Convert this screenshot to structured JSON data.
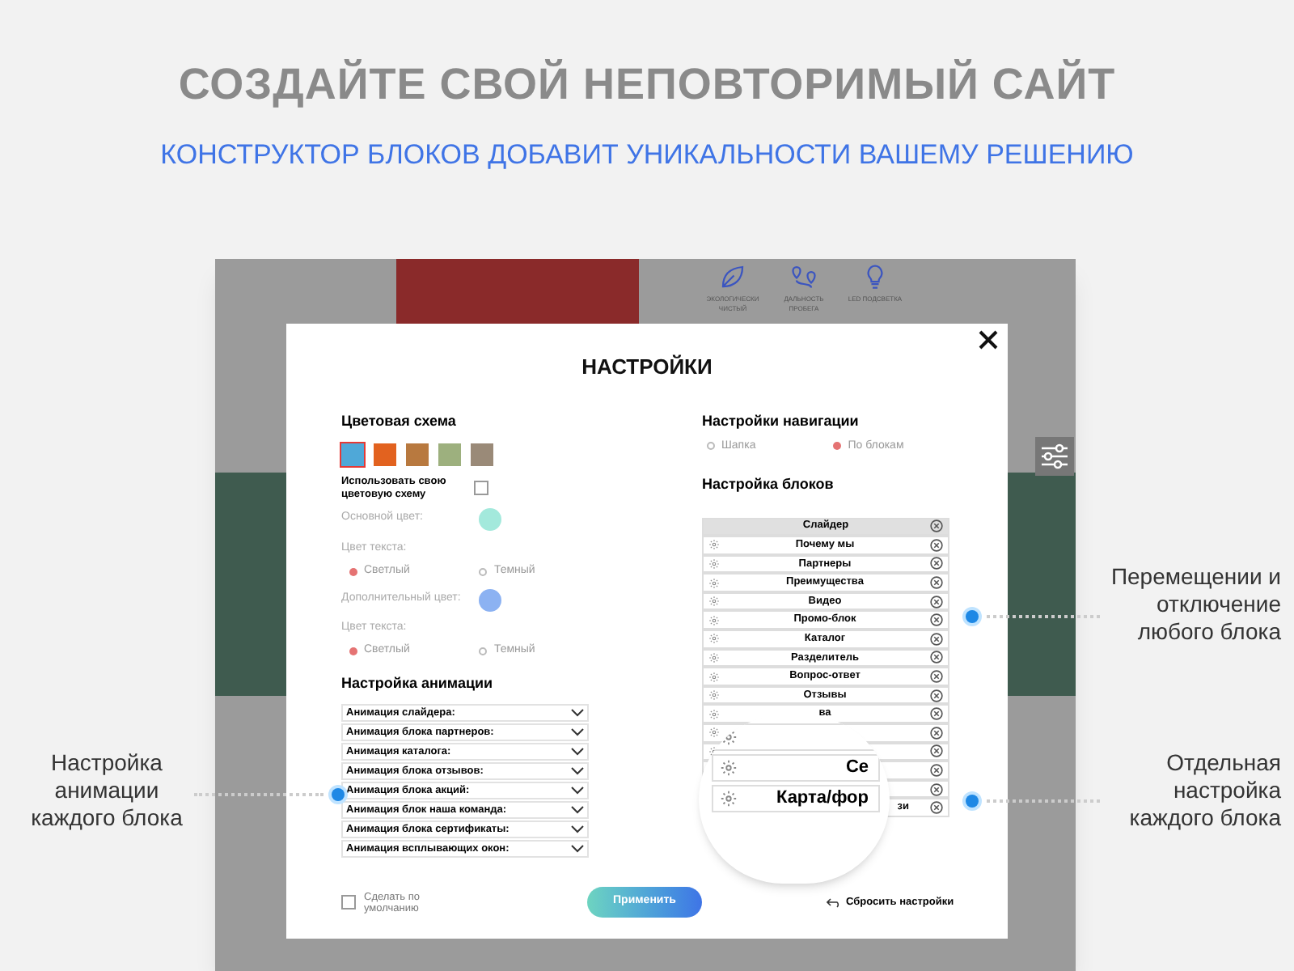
{
  "headline": "СОЗДАЙТЕ СВОЙ НЕПОВТОРИМЫЙ САЙТ",
  "subheadline": "КОНСТРУКТОР БЛОКОВ ДОБАВИТ УНИКАЛЬНОСТИ ВАШЕМУ РЕШЕНИЮ",
  "site_preview": {
    "features": [
      {
        "kind": "leaf",
        "label": "ЭКОЛОГИЧЕСКИ ЧИСТЫЙ"
      },
      {
        "kind": "route",
        "label": "ДАЛЬНОСТЬ ПРОБЕГА"
      },
      {
        "kind": "bulb",
        "label": "LED ПОДСВЕТКА"
      }
    ]
  },
  "dialog": {
    "title": "НАСТРОЙКИ",
    "color_scheme": {
      "heading": "Цветовая схема",
      "swatches": [
        {
          "color": "#4fa8d8",
          "selected": true
        },
        {
          "color": "#e2621f",
          "selected": false
        },
        {
          "color": "#b8793f",
          "selected": false
        },
        {
          "color": "#9db07e",
          "selected": false
        },
        {
          "color": "#9a8a78",
          "selected": false
        }
      ],
      "custom_label": "Использовать свою цветовую схему",
      "custom_checked": false,
      "main": {
        "label": "Основной цвет:",
        "color": "#a3e9dc"
      },
      "text_color_label": "Цвет текста:",
      "text_options": [
        {
          "label": "Светлый",
          "selected": true
        },
        {
          "label": "Темный",
          "selected": false
        }
      ],
      "extra": {
        "label": "Дополнительный цвет:",
        "color": "#8cb2f2"
      },
      "text_color_label_2": "Цвет текста:",
      "text_options_2": [
        {
          "label": "Светлый",
          "selected": true
        },
        {
          "label": "Темный",
          "selected": false
        }
      ]
    },
    "animation": {
      "heading": "Настройка анимации",
      "items": [
        "Анимация слайдера:",
        "Анимация блока партнеров:",
        "Анимация каталога:",
        "Анимация блока отзывов:",
        "Анимация блока акций:",
        "Анимация блок наша команда:",
        "Анимация блока сертификаты:",
        "Анимация всплывающих окон:"
      ]
    },
    "navigation": {
      "heading": "Настройки навигации",
      "options": [
        {
          "label": "Шапка",
          "selected": false
        },
        {
          "label": "По блокам",
          "selected": true
        }
      ]
    },
    "blocks": {
      "heading": "Настройка блоков",
      "rows": [
        {
          "label": "Слайдер",
          "selected": true
        },
        {
          "label": "Почему мы",
          "selected": false
        },
        {
          "label": "Партнеры",
          "selected": false
        },
        {
          "label": "Преимущества",
          "selected": false
        },
        {
          "label": "Видео",
          "selected": false
        },
        {
          "label": "Промо-блок",
          "selected": false
        },
        {
          "label": "Каталог",
          "selected": false
        },
        {
          "label": "Разделитель",
          "selected": false
        },
        {
          "label": "Вопрос-ответ",
          "selected": false
        },
        {
          "label": "Отзывы",
          "selected": false
        },
        {
          "label": "ва",
          "selected": false
        },
        {
          "selected": false
        },
        {
          "selected": false
        },
        {
          "selected": false
        },
        {
          "selected": false
        },
        {
          "label": "зи",
          "kind": "tail",
          "selected": false
        }
      ],
      "magnified_rows": [
        {},
        {
          "label": "Се"
        },
        {
          "label": "Карта/фор"
        }
      ]
    },
    "default_label": "Сделать по умолчанию",
    "default_checked": false,
    "apply_button": "Применить",
    "reset_link": "Сбросить настройки"
  },
  "callouts": [
    {
      "kind": "right_top",
      "text": "Перемещении и отключение любого блока"
    },
    {
      "kind": "left",
      "text": "Настройка анимации каждого блока"
    },
    {
      "kind": "right_bottom",
      "text": "Отдельная настройка каждого блока"
    }
  ]
}
